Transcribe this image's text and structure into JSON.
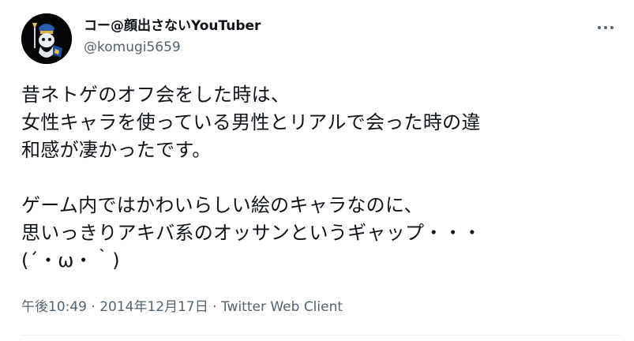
{
  "user": {
    "display_name": "コー@顔出さないYouTuber",
    "handle": "@komugi5659"
  },
  "tweet": {
    "text": "昔ネトゲのオフ会をした時は、\n女性キャラを使っている男性とリアルで会った時の違\n和感が凄かったです。\n\nゲーム内ではかわいらしい絵のキャラなのに、\n思いっきりアキバ系のオッサンというギャップ・・・\n(´・ω・｀)",
    "time": "午後10:49",
    "separator": "·",
    "date": "2014年12月17日",
    "client": "Twitter Web Client"
  },
  "icons": {
    "more": "more-horizontal-icon",
    "avatar": "avatar-character-image"
  },
  "colors": {
    "text_primary": "#0f1419",
    "text_secondary": "#536471",
    "divider": "#eff3f4"
  }
}
